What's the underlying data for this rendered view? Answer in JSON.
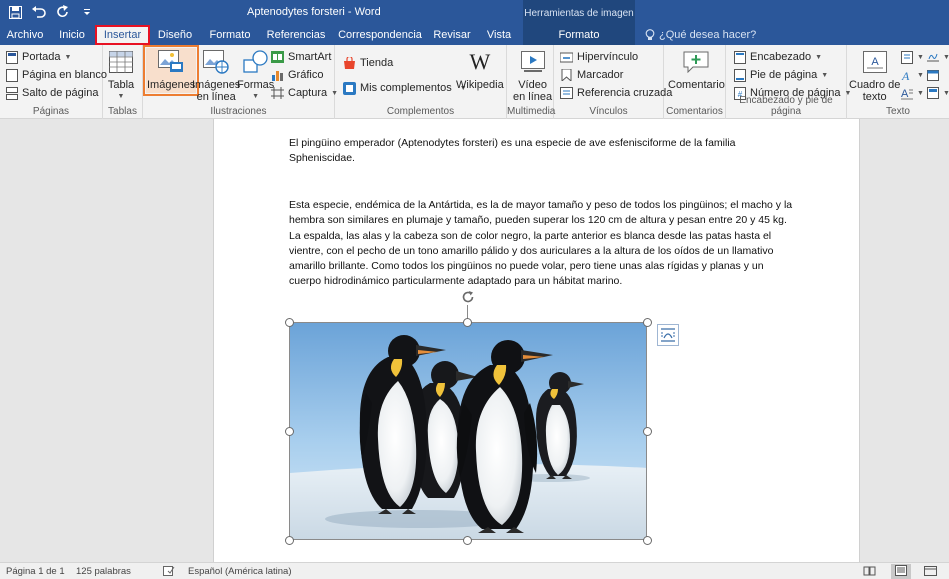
{
  "titlebar": {
    "doc_title": "Aptenodytes forsteri - Word",
    "context_title": "Herramientas de imagen"
  },
  "tabs": [
    {
      "label": "Archivo"
    },
    {
      "label": "Inicio"
    },
    {
      "label": "Insertar"
    },
    {
      "label": "Diseño"
    },
    {
      "label": "Formato"
    },
    {
      "label": "Referencias"
    },
    {
      "label": "Correspondencia"
    },
    {
      "label": "Revisar"
    },
    {
      "label": "Vista"
    },
    {
      "label": "Formato"
    }
  ],
  "tell_me": "¿Qué desea hacer?",
  "ribbon": {
    "paginas": {
      "label": "Páginas",
      "portada": "Portada",
      "pagina_blanco": "Página en blanco",
      "salto": "Salto de página"
    },
    "tablas": {
      "label": "Tablas",
      "tabla": "Tabla"
    },
    "ilustraciones": {
      "label": "Ilustraciones",
      "imagenes": "Imágenes",
      "imagenes_linea_1": "Imágenes",
      "imagenes_linea_2": "en línea",
      "formas": "Formas",
      "smartart": "SmartArt",
      "grafico": "Gráfico",
      "captura": "Captura"
    },
    "complementos": {
      "label": "Complementos",
      "tienda": "Tienda",
      "mis": "Mis complementos",
      "wikipedia": "Wikipedia"
    },
    "multimedia": {
      "label": "Multimedia",
      "video_1": "Vídeo",
      "video_2": "en línea"
    },
    "vinculos": {
      "label": "Vínculos",
      "hipervinculo": "Hipervínculo",
      "marcador": "Marcador",
      "referencia": "Referencia cruzada"
    },
    "comentarios": {
      "label": "Comentarios",
      "comentario": "Comentario"
    },
    "encabezado": {
      "label": "Encabezado y pie de página",
      "encabezado": "Encabezado",
      "pie": "Pie de página",
      "numero": "Número de página"
    },
    "texto": {
      "label": "Texto",
      "cuadro_1": "Cuadro de",
      "cuadro_2": "texto"
    }
  },
  "document": {
    "paragraph1": "El pingüino emperador (Aptenodytes forsteri) es una especie de ave esfenisciforme de la familia Spheniscidae.",
    "paragraph2": "Esta especie, endémica de la Antártida, es la de mayor tamaño y peso de todos los pingüinos; el macho y la hembra son similares en plumaje y tamaño, pueden superar los 120 cm de altura y pesan entre 20 y 45 kg. La espalda, las alas y la cabeza son de color negro, la parte anterior es blanca desde las patas hasta el vientre, con el pecho de un tono amarillo pálido y dos auriculares a la altura de los oídos de un llamativo amarillo brillante. Como todos los pingüinos no puede volar, pero tiene unas alas rígidas y planas y un cuerpo hidrodinámico particularmente adaptado para un hábitat marino."
  },
  "statusbar": {
    "page": "Página 1 de 1",
    "words": "125 palabras",
    "language": "Español (América latina)"
  },
  "colors": {
    "brand": "#2b579a",
    "highlight_red": "#e81123",
    "highlight_orange": "#ed7d31"
  }
}
